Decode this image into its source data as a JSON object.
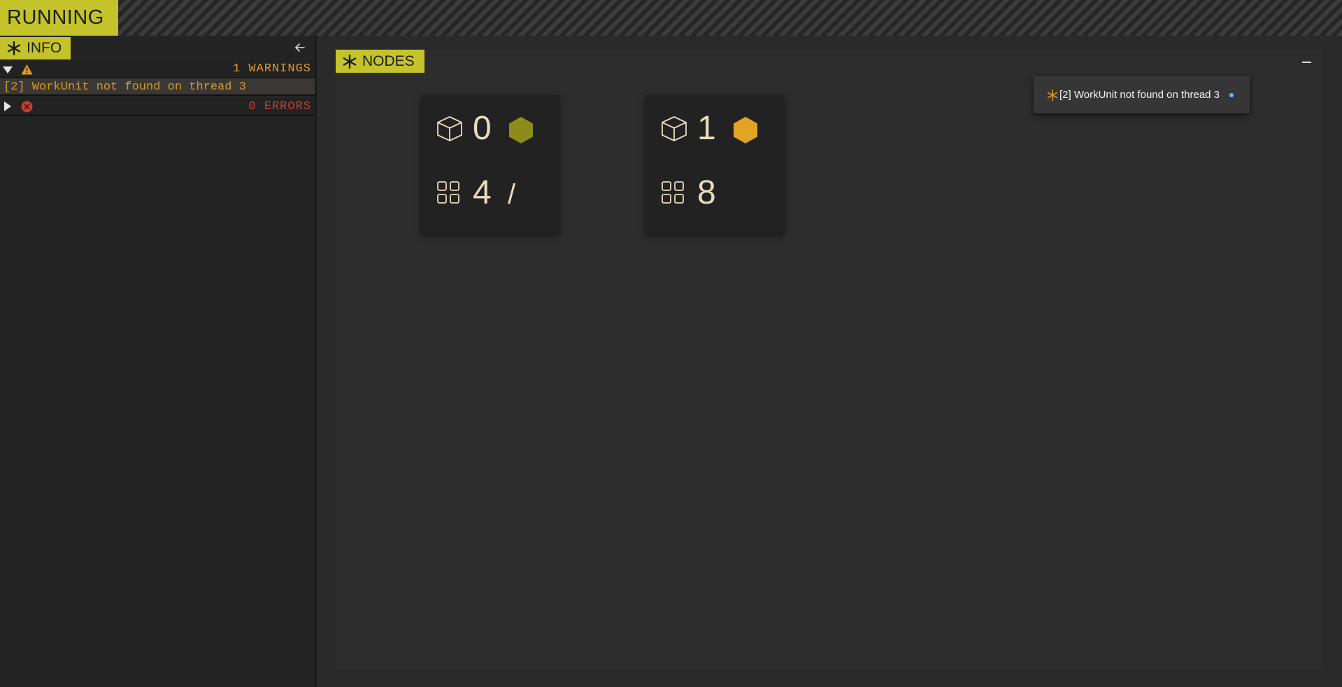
{
  "status": {
    "label": "RUNNING"
  },
  "info_panel": {
    "title": "INFO",
    "warnings": {
      "count_label": "1 WARNINGS",
      "expanded": true,
      "messages": [
        "[2] WorkUnit not found on thread 3"
      ]
    },
    "errors": {
      "count_label": "0 ERRORS",
      "expanded": false
    }
  },
  "nodes_panel": {
    "title": "NODES",
    "nodes": [
      {
        "id": "0",
        "workers": "4",
        "status_color": "#8c8c1c",
        "extra": "/"
      },
      {
        "id": "1",
        "workers": "8",
        "status_color": "#e2a424",
        "extra": ""
      }
    ]
  },
  "toast": {
    "message": "[2] WorkUnit not found on thread 3",
    "icon": "asterisk-icon",
    "dot_color": "#7aaef0"
  },
  "colors": {
    "accent": "#c5c32b",
    "warning": "#e29a22",
    "error": "#d23a2a"
  }
}
